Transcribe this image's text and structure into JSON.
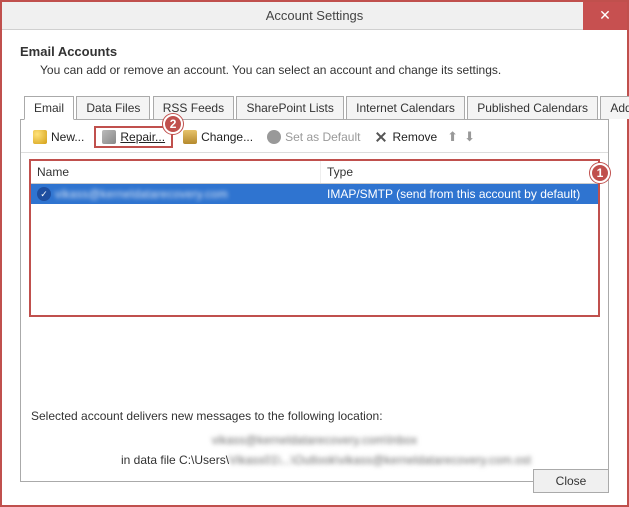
{
  "window": {
    "title": "Account Settings",
    "close_label": "Close"
  },
  "header": {
    "title": "Email Accounts",
    "subtitle": "You can add or remove an account. You can select an account and change its settings."
  },
  "tabs": [
    {
      "label": "Email",
      "active": true
    },
    {
      "label": "Data Files"
    },
    {
      "label": "RSS Feeds"
    },
    {
      "label": "SharePoint Lists"
    },
    {
      "label": "Internet Calendars"
    },
    {
      "label": "Published Calendars"
    },
    {
      "label": "Address Books"
    }
  ],
  "toolbar": {
    "new": "New...",
    "repair": "Repair...",
    "change": "Change...",
    "set_default": "Set as Default",
    "remove": "Remove"
  },
  "table": {
    "columns": {
      "name": "Name",
      "type": "Type"
    },
    "rows": [
      {
        "name": "vikass@kerneldatarecovery.com",
        "type": "IMAP/SMTP (send from this account by default)",
        "default": true,
        "selected": true
      }
    ]
  },
  "footer": {
    "intro": "Selected account delivers new messages to the following location:",
    "line1": "vikass@kerneldatarecovery.com\\Inbox",
    "line2a": "in data file C:\\Users\\",
    "line2b": "Vikass01\\...\\Outlook\\vikass@kerneldatarecovery.com.ost"
  },
  "annotations": {
    "badge1": "1",
    "badge2": "2"
  }
}
